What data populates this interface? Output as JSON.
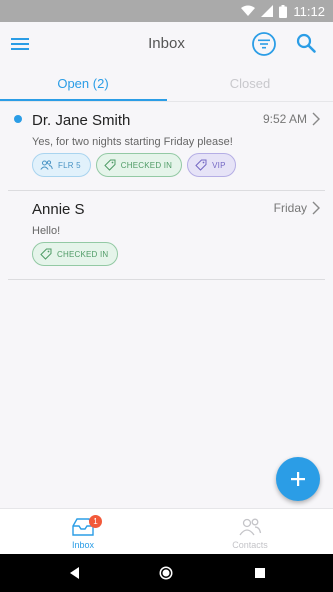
{
  "status_bar": {
    "time": "11:12"
  },
  "app_bar": {
    "title": "Inbox",
    "menu_icon": "menu-icon",
    "filter_icon": "filter-icon",
    "search_icon": "search-icon"
  },
  "tabs": [
    {
      "label": "Open (2)",
      "active": true
    },
    {
      "label": "Closed",
      "active": false
    }
  ],
  "conversations": [
    {
      "name": "Dr. Jane Smith",
      "time": "9:52 AM",
      "preview": "Yes, for two nights starting Friday please!",
      "unread": true,
      "tags": [
        {
          "label": "FLR 5",
          "icon": "people-icon",
          "color": "#4a94c4"
        },
        {
          "label": "CHECKED IN",
          "icon": "tag-icon",
          "color": "#4f9b66"
        },
        {
          "label": "VIP",
          "icon": "tag-icon",
          "color": "#7468c4"
        }
      ]
    },
    {
      "name": "Annie S",
      "time": "Friday",
      "preview": "Hello!",
      "unread": false,
      "tags": [
        {
          "label": "CHECKED IN",
          "icon": "tag-icon",
          "color": "#4f9b66"
        }
      ]
    }
  ],
  "fab": {
    "icon": "plus-icon"
  },
  "bottom_nav": [
    {
      "label": "Inbox",
      "icon": "inbox-icon",
      "badge": "1",
      "active": true
    },
    {
      "label": "Contacts",
      "icon": "contacts-icon",
      "active": false
    }
  ],
  "colors": {
    "accent": "#2b9de6",
    "badge": "#f2593a"
  }
}
